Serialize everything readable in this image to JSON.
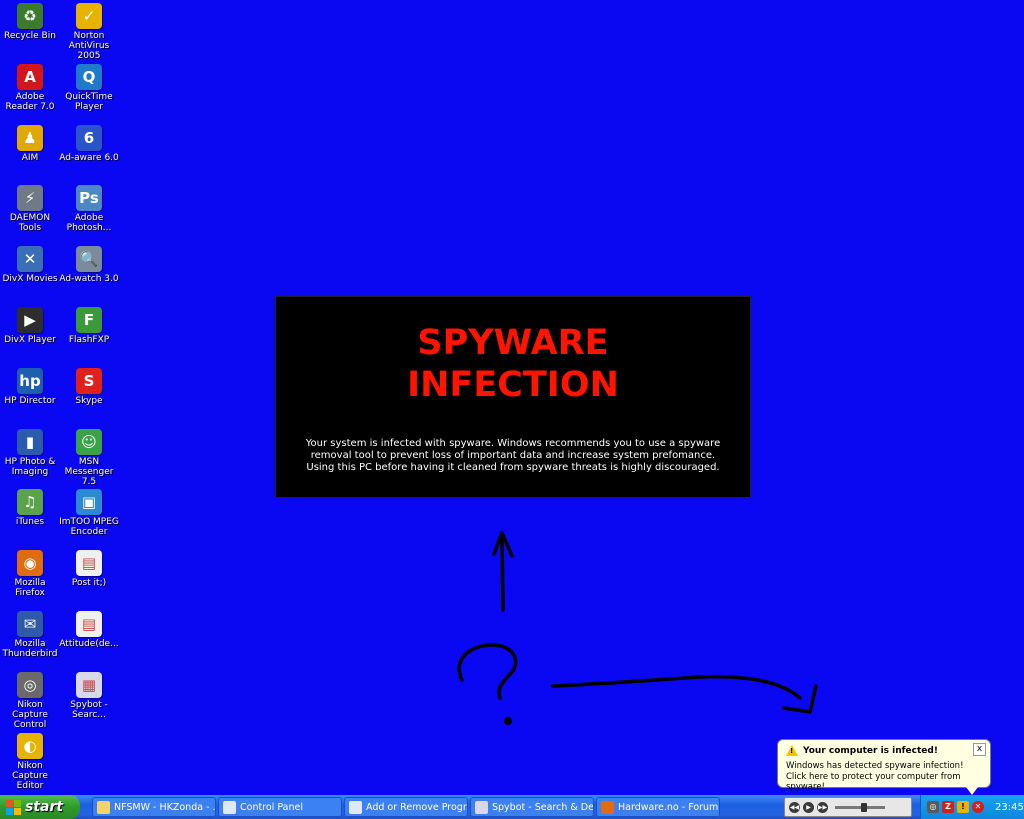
{
  "desktop": {
    "icons": [
      {
        "label": "Recycle Bin",
        "icon": "recycle-bin-icon",
        "color": "#3c7a2c",
        "glyph": "♻"
      },
      {
        "label": "Norton AntiVirus 2005",
        "icon": "norton-antivirus-icon",
        "color": "#e6b400",
        "glyph": "✓"
      },
      {
        "label": "Adobe Reader 7.0",
        "icon": "adobe-reader-icon",
        "color": "#d2161a",
        "glyph": "A"
      },
      {
        "label": "QuickTime Player",
        "icon": "quicktime-icon",
        "color": "#1f7acc",
        "glyph": "Q"
      },
      {
        "label": "AIM",
        "icon": "aim-icon",
        "color": "#e0a800",
        "glyph": "♟"
      },
      {
        "label": "Ad-aware 6.0",
        "icon": "adaware-icon",
        "color": "#2a55c9",
        "glyph": "6"
      },
      {
        "label": "DAEMON Tools",
        "icon": "daemon-tools-icon",
        "color": "#6f7a86",
        "glyph": "⚡"
      },
      {
        "label": "Adobe Photosh...",
        "icon": "photoshop-icon",
        "color": "#4c88c6",
        "glyph": "Ps"
      },
      {
        "label": "DivX Movies",
        "icon": "divx-movies-icon",
        "color": "#3a6fb8",
        "glyph": "✕"
      },
      {
        "label": "Ad-watch 3.0",
        "icon": "adwatch-icon",
        "color": "#7a8c9c",
        "glyph": "🔍"
      },
      {
        "label": "DivX Player",
        "icon": "divx-player-icon",
        "color": "#2d2d2d",
        "glyph": "▶"
      },
      {
        "label": "FlashFXP",
        "icon": "flashfxp-icon",
        "color": "#3a9a3a",
        "glyph": "F"
      },
      {
        "label": "HP Director",
        "icon": "hp-director-icon",
        "color": "#1d5fae",
        "glyph": "hp"
      },
      {
        "label": "Skype",
        "icon": "skype-icon",
        "color": "#e0201a",
        "glyph": "S"
      },
      {
        "label": "HP Photo & Imaging",
        "icon": "hp-photo-icon",
        "color": "#2b5cab",
        "glyph": "▮"
      },
      {
        "label": "MSN Messenger 7.5",
        "icon": "msn-messenger-icon",
        "color": "#3aa34a",
        "glyph": "☺"
      },
      {
        "label": "iTunes",
        "icon": "itunes-icon",
        "color": "#5aa34a",
        "glyph": "♫"
      },
      {
        "label": "ImTOO MPEG Encoder",
        "icon": "imtoo-icon",
        "color": "#2b8ad6",
        "glyph": "▣"
      },
      {
        "label": "Mozilla Firefox",
        "icon": "firefox-icon",
        "color": "#e06c10",
        "glyph": "◉"
      },
      {
        "label": "Post it;)",
        "icon": "post-it-file-icon",
        "color": "#f0f0f0",
        "glyph": "▤"
      },
      {
        "label": "Mozilla Thunderbird",
        "icon": "thunderbird-icon",
        "color": "#2f5aa8",
        "glyph": "✉"
      },
      {
        "label": "Attitude(de...",
        "icon": "attitude-file-icon",
        "color": "#f0f0f0",
        "glyph": "▤"
      },
      {
        "label": "Nikon Capture Control",
        "icon": "nikon-capture-control-icon",
        "color": "#6a6a6a",
        "glyph": "◎"
      },
      {
        "label": "Spybot - Searc...",
        "icon": "spybot-icon",
        "color": "#d8d8e8",
        "glyph": "▦"
      },
      {
        "label": "Nikon Capture Editor",
        "icon": "nikon-capture-editor-icon",
        "color": "#e6b400",
        "glyph": "◐"
      }
    ]
  },
  "popup": {
    "title": "SPYWARE\nINFECTION",
    "message": "Your system is infected with spyware. Windows recommends you to use a spyware removal tool to prevent loss of important data and increase system prefomance. Using this PC before having it cleaned from spyware threats is highly discouraged."
  },
  "balloon": {
    "title": "Your computer is infected!",
    "line1": "Windows has detected spyware infection!",
    "line2": "Click here to protect your computer from spyware!",
    "close": "x"
  },
  "taskbar": {
    "start_label": "start",
    "tasks": [
      {
        "label": "NFSMW - HKZonda - ...",
        "icon": "folder-icon",
        "color": "#f4d46a"
      },
      {
        "label": "Control Panel",
        "icon": "control-panel-icon",
        "color": "#dfe8f6"
      },
      {
        "label": "Add or Remove Progr...",
        "icon": "add-remove-programs-icon",
        "color": "#dfe8f6"
      },
      {
        "label": "Spybot - Search & De...",
        "icon": "spybot-icon",
        "color": "#d8d8e8"
      },
      {
        "label": "Hardware.no - Forum...",
        "icon": "firefox-icon",
        "color": "#e06c10"
      }
    ],
    "clock": "23:45"
  }
}
